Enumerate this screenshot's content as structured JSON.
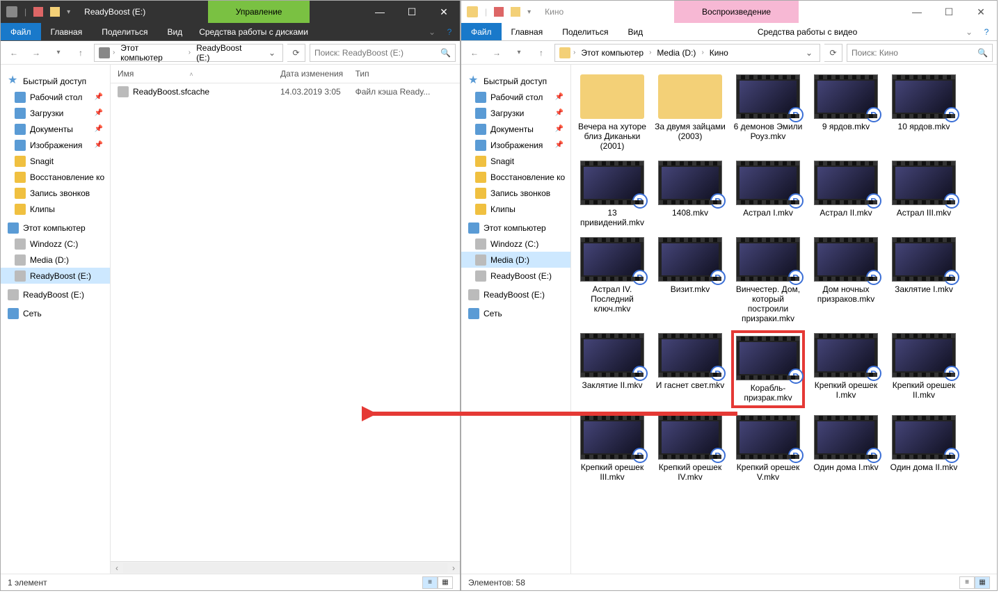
{
  "left": {
    "title": "ReadyBoost (E:)",
    "contextTab": "Управление",
    "ribbon": {
      "file": "Файл",
      "tabs": [
        "Главная",
        "Поделиться",
        "Вид"
      ],
      "tool": "Средства работы с дисками"
    },
    "breadcrumbs": [
      "Этот компьютер",
      "ReadyBoost (E:)"
    ],
    "searchPlaceholder": "Поиск: ReadyBoost (E:)",
    "columns": {
      "name": "Имя",
      "date": "Дата изменения",
      "type": "Тип"
    },
    "files": [
      {
        "name": "ReadyBoost.sfcache",
        "date": "14.03.2019 3:05",
        "type": "Файл кэша Ready..."
      }
    ],
    "status": "1 элемент"
  },
  "right": {
    "title": "Кино",
    "contextTab": "Воспроизведение",
    "ribbon": {
      "file": "Файл",
      "tabs": [
        "Главная",
        "Поделиться",
        "Вид"
      ],
      "tool": "Средства работы с видео"
    },
    "breadcrumbs": [
      "Этот компьютер",
      "Media (D:)",
      "Кино"
    ],
    "searchPlaceholder": "Поиск: Кино",
    "items": [
      {
        "label": "Вечера на хуторе близ Диканьки (2001)",
        "folder": true
      },
      {
        "label": "За двумя зайцами (2003)",
        "folder": true
      },
      {
        "label": "6 демонов Эмили Роуз.mkv"
      },
      {
        "label": "9 ярдов.mkv"
      },
      {
        "label": "10 ярдов.mkv"
      },
      {
        "label": "13 привидений.mkv"
      },
      {
        "label": "1408.mkv"
      },
      {
        "label": "Астрал I.mkv"
      },
      {
        "label": "Астрал II.mkv"
      },
      {
        "label": "Астрал III.mkv"
      },
      {
        "label": "Астрал IV. Последний ключ.mkv"
      },
      {
        "label": "Визит.mkv"
      },
      {
        "label": "Винчестер. Дом, который построили призраки.mkv"
      },
      {
        "label": "Дом ночных призраков.mkv"
      },
      {
        "label": "Заклятие I.mkv"
      },
      {
        "label": "Заклятие II.mkv"
      },
      {
        "label": "И гаснет свет.mkv"
      },
      {
        "label": "Корабль-призрак.mkv",
        "highlighted": true
      },
      {
        "label": "Крепкий орешек I.mkv"
      },
      {
        "label": "Крепкий орешек II.mkv"
      },
      {
        "label": "Крепкий орешек III.mkv"
      },
      {
        "label": "Крепкий орешек IV.mkv"
      },
      {
        "label": "Крепкий орешек V.mkv"
      },
      {
        "label": "Один дома I.mkv"
      },
      {
        "label": "Один дома II.mkv"
      }
    ],
    "status": "Элементов: 58"
  },
  "nav": {
    "quickAccess": "Быстрый доступ",
    "desktop": "Рабочий стол",
    "downloads": "Загрузки",
    "documents": "Документы",
    "pictures": "Изображения",
    "snagit": "Snagit",
    "recovery": "Восстановление ко",
    "recordings": "Запись звонков",
    "clips": "Клипы",
    "thisPC": "Этот компьютер",
    "driveC": "Windozz (C:)",
    "driveD": "Media (D:)",
    "driveE": "ReadyBoost (E:)",
    "driveE2": "ReadyBoost (E:)",
    "network": "Сеть"
  }
}
